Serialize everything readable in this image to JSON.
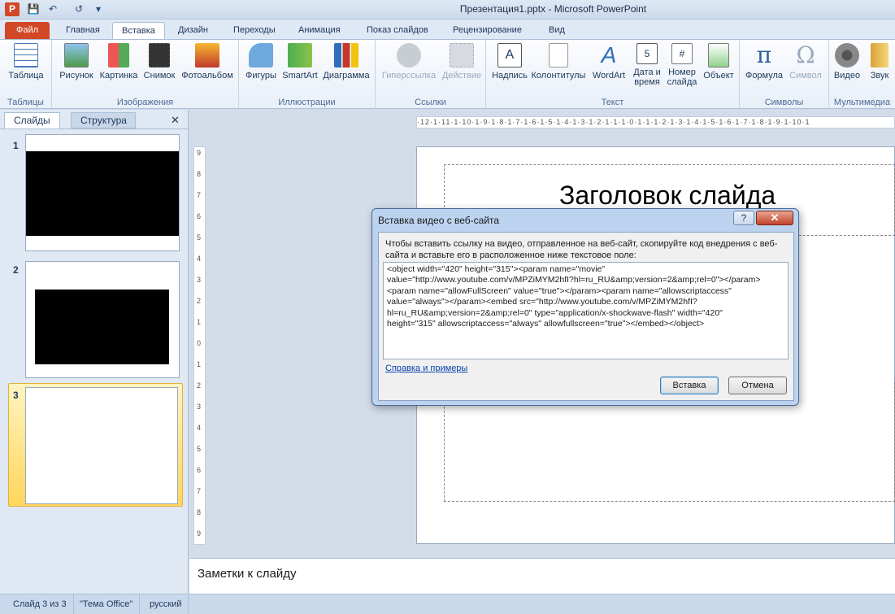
{
  "window": {
    "title": "Презентация1.pptx  -  Microsoft PowerPoint",
    "app_icon": "P"
  },
  "quick_access": [
    "save-icon",
    "undo-icon",
    "redo-icon",
    "customize-icon"
  ],
  "tabs": [
    {
      "label": "Файл"
    },
    {
      "label": "Главная"
    },
    {
      "label": "Вставка",
      "active": true
    },
    {
      "label": "Дизайн"
    },
    {
      "label": "Переходы"
    },
    {
      "label": "Анимация"
    },
    {
      "label": "Показ слайдов"
    },
    {
      "label": "Рецензирование"
    },
    {
      "label": "Вид"
    }
  ],
  "ribbon": {
    "groups": {
      "tables": "Таблицы",
      "images": "Изображения",
      "illustrations": "Иллюстрации",
      "links": "Ссылки",
      "text": "Текст",
      "symbols": "Символы",
      "media": "Мультимедиа"
    },
    "buttons": {
      "table": "Таблица",
      "picture": "Рисунок",
      "clipart": "Картинка",
      "screenshot": "Снимок",
      "photoalbum": "Фотоальбом",
      "shapes": "Фигуры",
      "smartart": "SmartArt",
      "chart": "Диаграмма",
      "hyperlink": "Гиперссылка",
      "action": "Действие",
      "textbox": "Надпись",
      "headerfooter": "Колонтитулы",
      "wordart": "WordArt",
      "datetime_1": "Дата и",
      "datetime_2": "время",
      "slidenum_1": "Номер",
      "slidenum_2": "слайда",
      "object": "Объект",
      "equation": "Формула",
      "symbol": "Символ",
      "video": "Видео",
      "audio": "Звук"
    }
  },
  "panel": {
    "tab_slides": "Слайды",
    "tab_outline": "Структура",
    "close": "✕",
    "thumbs": [
      "1",
      "2",
      "3"
    ]
  },
  "ruler": {
    "horizontal": "·12·1·11·1·10·1·9·1·8·1·7·1·6·1·5·1·4·1·3·1·2·1·1·1·0·1·1·1·2·1·3·1·4·1·5·1·6·1·7·1·8·1·9·1·10·1",
    "vertical": [
      "9",
      "8",
      "7",
      "6",
      "5",
      "4",
      "3",
      "2",
      "1",
      "0",
      "1",
      "2",
      "3",
      "4",
      "5",
      "6",
      "7",
      "8",
      "9"
    ]
  },
  "slide": {
    "title": "Заголовок слайда"
  },
  "notes": {
    "placeholder": "Заметки к слайду"
  },
  "status": {
    "slide": "Слайд 3 из 3",
    "theme": "\"Тема Office\"",
    "language": "русский"
  },
  "dialog": {
    "title": "Вставка видео с веб-сайта",
    "help": "?",
    "close": "✕",
    "instructions": "Чтобы вставить ссылку на видео, отправленное на веб-сайт, скопируйте код внедрения с веб-сайта и вставьте его в расположенное ниже текстовое поле:",
    "embed_code": "<object width=\"420\" height=\"315\"><param name=\"movie\"\nvalue=\"http://www.youtube.com/v/MPZiMYM2hfI?hl=ru_RU&amp;version=2&amp;rel=0\"></param>\n<param name=\"allowFullScreen\" value=\"true\"></param><param name=\"allowscriptaccess\"\nvalue=\"always\"></param><embed src=\"http://www.youtube.com/v/MPZiMYM2hfI?\nhl=ru_RU&amp;version=2&amp;rel=0\" type=\"application/x-shockwave-flash\" width=\"420\"\nheight=\"315\" allowscriptaccess=\"always\" allowfullscreen=\"true\"></embed></object>",
    "help_link": "Справка и примеры",
    "insert_button": "Вставка",
    "cancel_button": "Отмена"
  },
  "colors": {
    "file_tab": "#d24726",
    "ribbon_bg": "#e8eff8",
    "dialog_frame": "#bcd3ef"
  }
}
